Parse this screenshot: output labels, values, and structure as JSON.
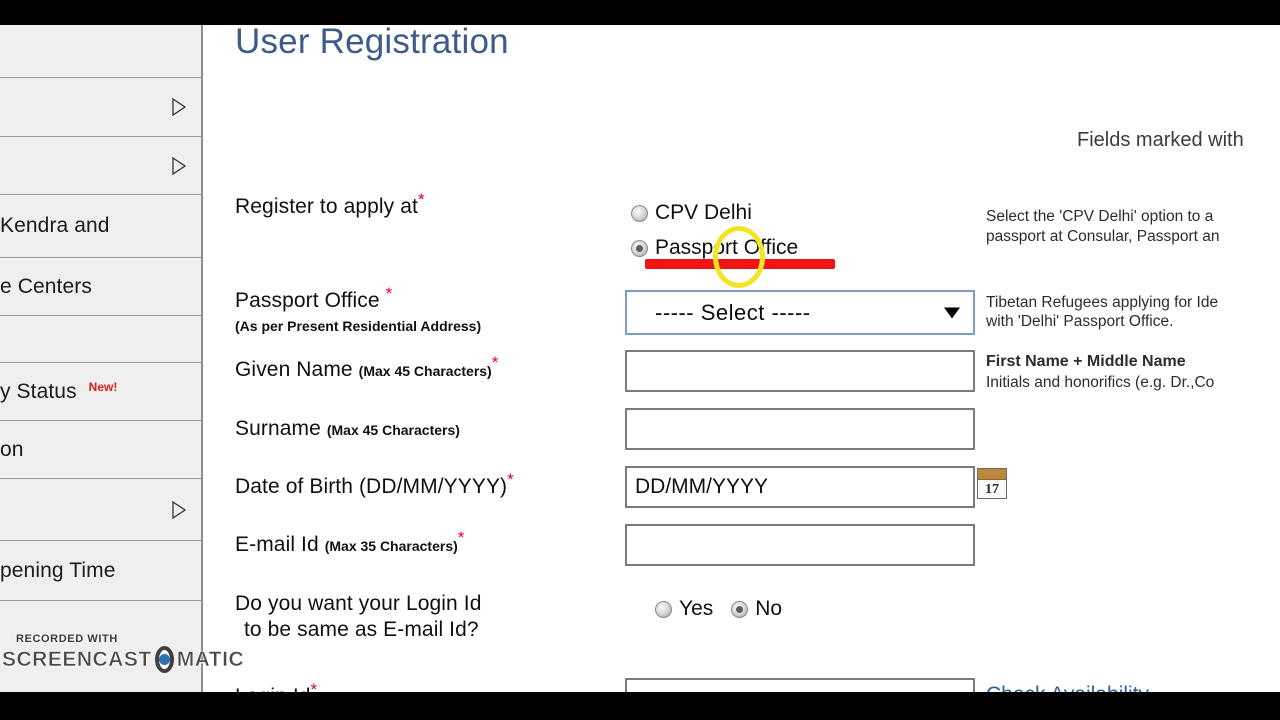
{
  "page": {
    "title": "User Registration",
    "fields_note": "Fields marked with"
  },
  "sidebar": {
    "items": [
      {
        "label": "",
        "arrow": false
      },
      {
        "label": "",
        "arrow": true
      },
      {
        "label": "",
        "arrow": true
      },
      {
        "label": "Kendra and",
        "arrow": false
      },
      {
        "label": "e Centers",
        "arrow": false
      },
      {
        "label": "",
        "arrow": false
      },
      {
        "label": "y Status",
        "badge": "New!",
        "arrow": false
      },
      {
        "label": "on",
        "arrow": false
      },
      {
        "label": "",
        "arrow": true
      },
      {
        "label": "pening Time",
        "arrow": false
      }
    ]
  },
  "form": {
    "register_at": {
      "label": "Register to apply at",
      "required": "*",
      "options": [
        {
          "label": "CPV Delhi",
          "selected": false
        },
        {
          "label": "Passport Office",
          "selected": true
        }
      ],
      "help": [
        "Select the 'CPV Delhi' option to a",
        "passport at Consular, Passport an"
      ]
    },
    "passport_office": {
      "label": "Passport Office",
      "required": "*",
      "sublabel": "(As per Present Residential Address)",
      "value": "----- Select -----",
      "help": [
        "Tibetan Refugees applying for Ide",
        "with 'Delhi' Passport Office."
      ]
    },
    "given_name": {
      "label": "Given Name",
      "hint": "(Max 45 Characters)",
      "required": "*",
      "value": "",
      "help_bold": "First Name + Middle Name",
      "help": "Initials and honorifics (e.g. Dr.,Co"
    },
    "surname": {
      "label": "Surname",
      "hint": "(Max 45 Characters)",
      "required": "",
      "value": ""
    },
    "dob": {
      "label": "Date of Birth (DD/MM/YYYY)",
      "required": "*",
      "value": "DD/MM/YYYY",
      "calendar_day": "17"
    },
    "email": {
      "label": "E-mail Id",
      "hint": "(Max 35 Characters)",
      "required": "*",
      "value": ""
    },
    "login_same": {
      "label_line1": "Do you want your Login Id",
      "label_line2": "to be same as E-mail Id?",
      "options": [
        {
          "label": "Yes",
          "selected": false
        },
        {
          "label": "No",
          "selected": true
        }
      ]
    },
    "login_id": {
      "label": "Login Id",
      "required": "*",
      "value": "",
      "link": "Check Availability"
    }
  },
  "annotations": {
    "red_underline_color": "#f01414",
    "yellow_circle_color": "#f3e524"
  },
  "watermark": {
    "recorded_with": "RECORDED WITH",
    "word1": "SCREENCAST",
    "word2": "MATIC"
  }
}
